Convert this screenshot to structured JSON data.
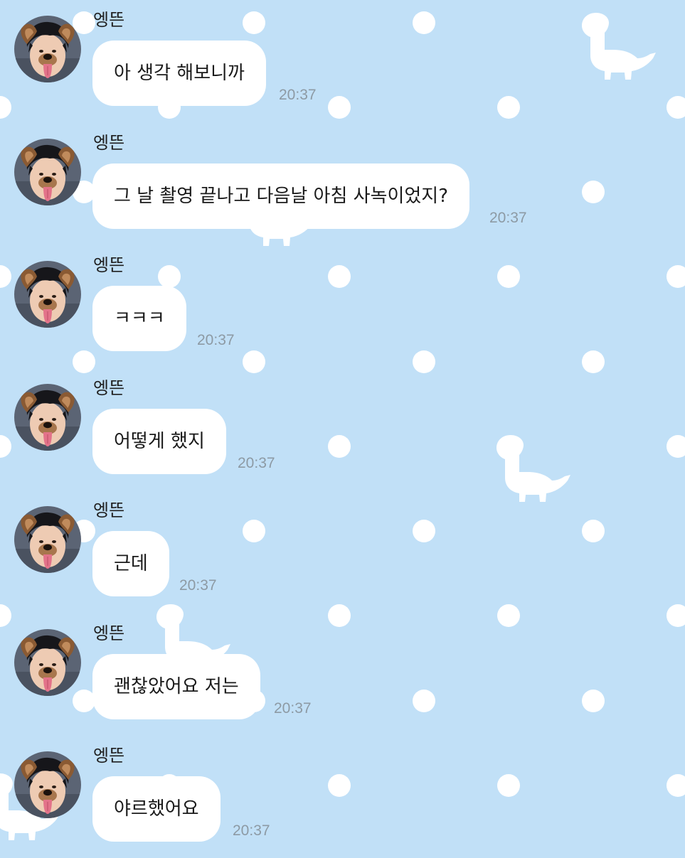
{
  "colors": {
    "background": "#c1e0f7",
    "bubble": "#ffffff",
    "sender_text": "#1f1f1f",
    "time_text": "#8d9aa4",
    "pattern": "#ffffff"
  },
  "background_pattern": {
    "dot_icon": "polka-dot",
    "animal_icon": "dinosaur-icon"
  },
  "messages": [
    {
      "sender": "엥뜬",
      "text": "아 생각 해보니까",
      "time": "20:37",
      "avatar_icon": "puppy-filter-avatar-icon"
    },
    {
      "sender": "엥뜬",
      "text": "그 날 촬영 끝나고 다음날 아침 사녹이었지?",
      "time": "20:37",
      "avatar_icon": "puppy-filter-avatar-icon"
    },
    {
      "sender": "엥뜬",
      "text": "ㅋㅋㅋ",
      "time": "20:37",
      "avatar_icon": "puppy-filter-avatar-icon"
    },
    {
      "sender": "엥뜬",
      "text": "어떻게 했지",
      "time": "20:37",
      "avatar_icon": "puppy-filter-avatar-icon"
    },
    {
      "sender": "엥뜬",
      "text": "근데",
      "time": "20:37",
      "avatar_icon": "puppy-filter-avatar-icon"
    },
    {
      "sender": "엥뜬",
      "text": "괜찮았어요 저는",
      "time": "20:37",
      "avatar_icon": "puppy-filter-avatar-icon"
    },
    {
      "sender": "엥뜬",
      "text": "야르했어요",
      "time": "20:37",
      "avatar_icon": "puppy-filter-avatar-icon"
    }
  ]
}
